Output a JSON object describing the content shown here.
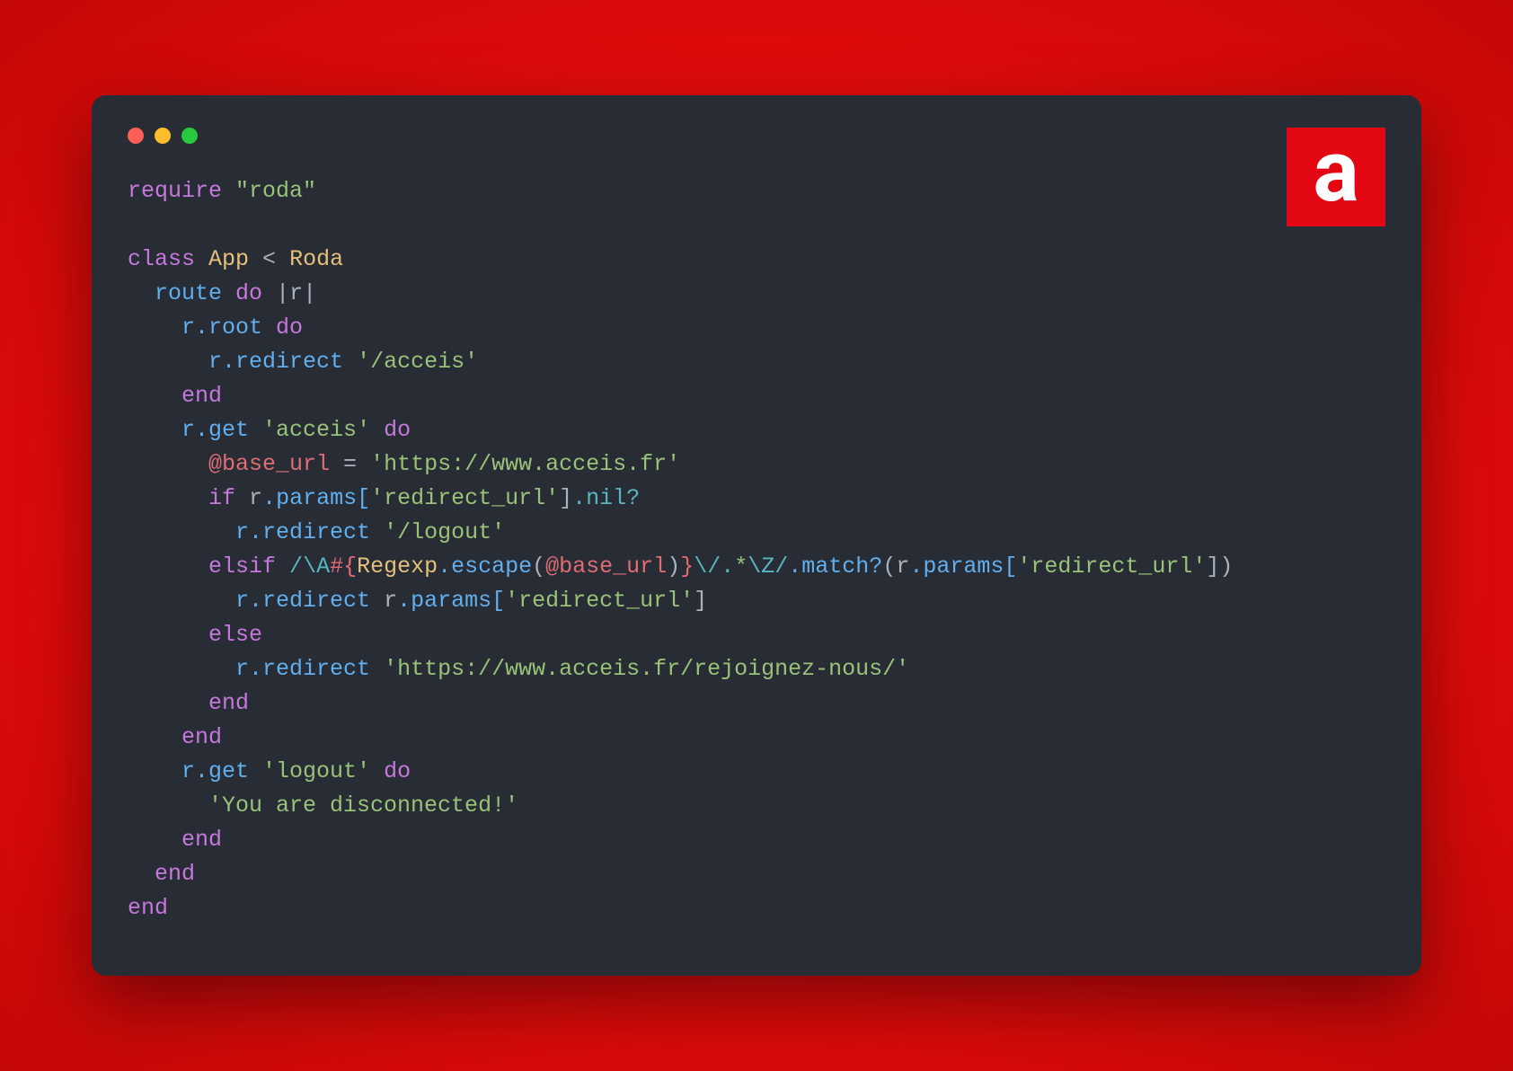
{
  "logo_letter": "a",
  "code": {
    "l1_require": "require",
    "l1_roda": "\"roda\"",
    "l3_class": "class",
    "l3_App": "App",
    "l3_lt": " < ",
    "l3_Roda": "Roda",
    "l4_route": "route",
    "l4_do": "do",
    "l4_pipe": " |r|",
    "l5_rroot": "r.root",
    "l5_do": "do",
    "l6_rredirect": "r.redirect",
    "l6_str": "'/acceis'",
    "l7_end": "end",
    "l8_rget": "r.get",
    "l8_str": "'acceis'",
    "l8_do": "do",
    "l9_ivar": "@base_url",
    "l9_eq": " = ",
    "l9_str": "'https://www.acceis.fr'",
    "l10_if": "if",
    "l10_r": "r",
    "l10_params": ".params[",
    "l10_key": "'redirect_url'",
    "l10_close": "]",
    "l10_nil": ".nil?",
    "l11_rredirect": "r.redirect",
    "l11_str": "'/logout'",
    "l12_elsif": "elsif",
    "l12_rgx_open": "/",
    "l12_rgx_a": "\\A",
    "l12_rgx_hash": "#{",
    "l12_Regexp": "Regexp",
    "l12_escape": ".escape",
    "l12_lpar": "(",
    "l12_ivar": "@base_url",
    "l12_rpar": ")",
    "l12_rgx_hashend": "}",
    "l12_rgx_rest": "\\/.",
    "l12_rgx_star": "*",
    "l12_rgx_Z": "\\Z",
    "l12_rgx_close": "/",
    "l12_match": ".match?",
    "l12_lpar2": "(",
    "l12_r2": "r",
    "l12_params2": ".params[",
    "l12_key2": "'redirect_url'",
    "l12_close2": "])",
    "l13_rredirect": "r.redirect",
    "l13_r": "r",
    "l13_params": ".params[",
    "l13_key": "'redirect_url'",
    "l13_close": "]",
    "l14_else": "else",
    "l15_rredirect": "r.redirect",
    "l15_str": "'https://www.acceis.fr/rejoignez-nous/'",
    "l16_end": "end",
    "l17_end": "end",
    "l18_rget": "r.get",
    "l18_str": "'logout'",
    "l18_do": "do",
    "l19_str": "'You are disconnected!'",
    "l20_end": "end",
    "l21_end": "end",
    "l22_end": "end"
  }
}
